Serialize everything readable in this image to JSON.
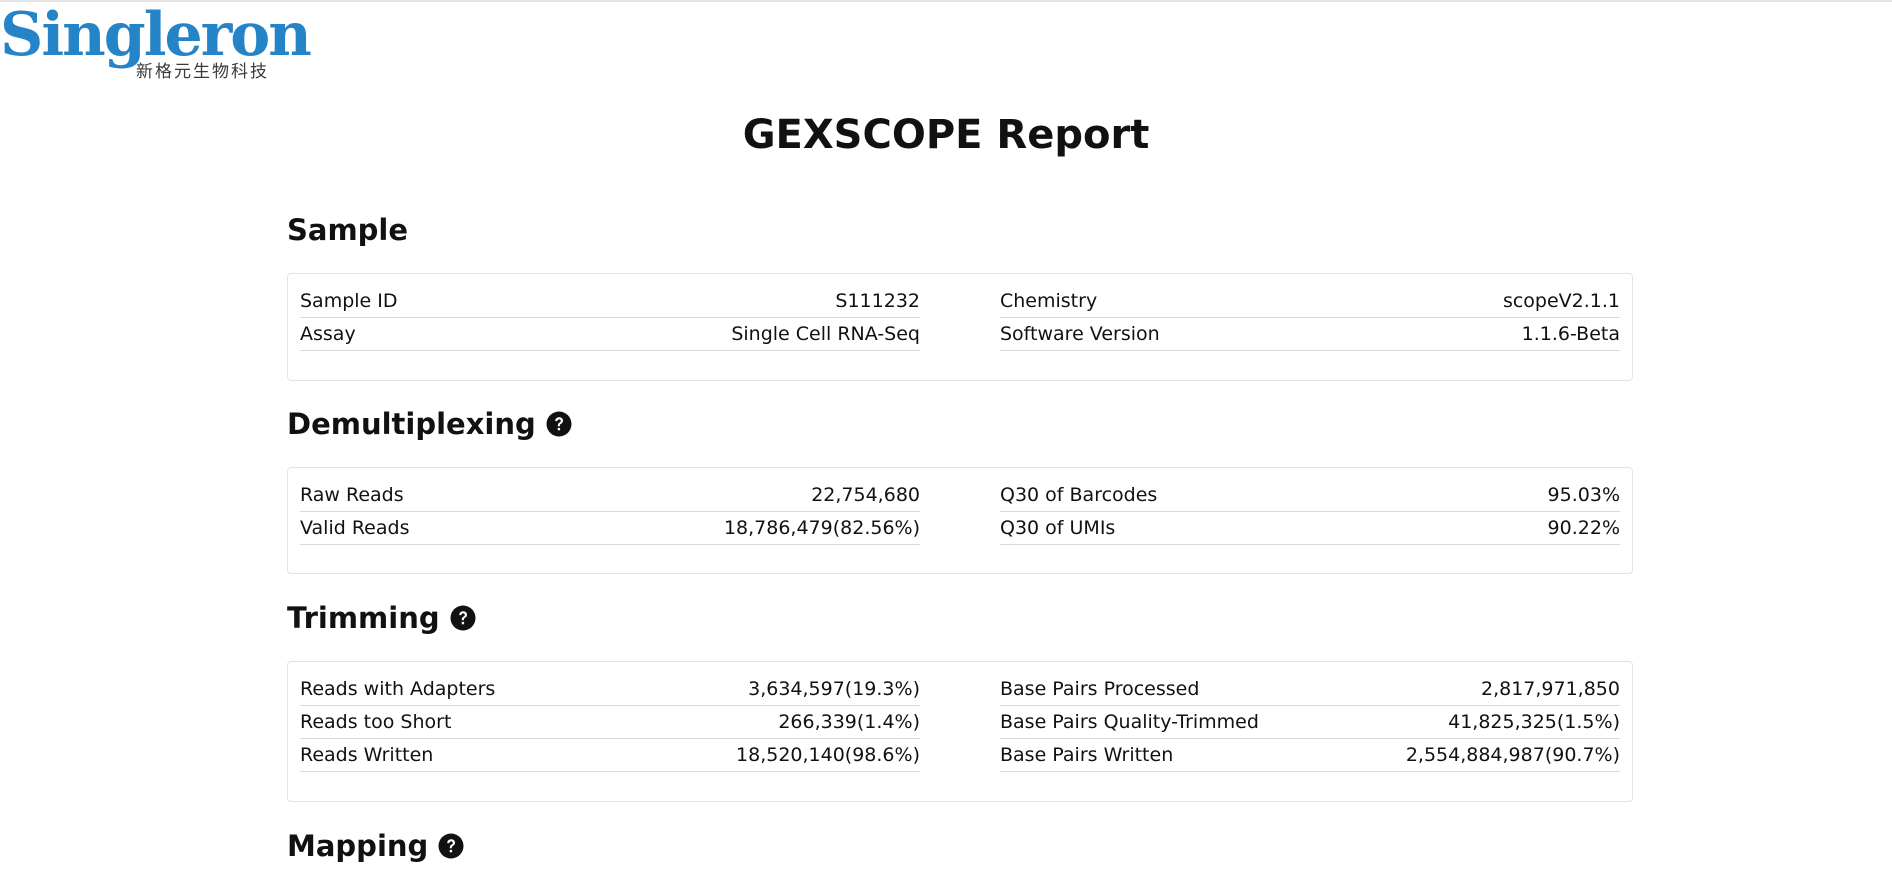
{
  "logo": {
    "word": "Singleron",
    "subtitle": "新格元生物科技",
    "color": "#2584c8"
  },
  "title": "GEXSCOPE Report",
  "help_icon": "question-circle-icon",
  "sections": {
    "sample": {
      "title": "Sample",
      "left": [
        {
          "label": "Sample ID",
          "value": "S111232"
        },
        {
          "label": "Assay",
          "value": "Single Cell RNA-Seq"
        }
      ],
      "right": [
        {
          "label": "Chemistry",
          "value": "scopeV2.1.1"
        },
        {
          "label": "Software Version",
          "value": "1.1.6-Beta"
        }
      ]
    },
    "demultiplexing": {
      "title": "Demultiplexing",
      "left": [
        {
          "label": "Raw Reads",
          "value": "22,754,680"
        },
        {
          "label": "Valid Reads",
          "value": "18,786,479(82.56%)"
        }
      ],
      "right": [
        {
          "label": "Q30 of Barcodes",
          "value": "95.03%"
        },
        {
          "label": "Q30 of UMIs",
          "value": "90.22%"
        }
      ]
    },
    "trimming": {
      "title": "Trimming",
      "left": [
        {
          "label": "Reads with Adapters",
          "value": "3,634,597(19.3%)"
        },
        {
          "label": "Reads too Short",
          "value": "266,339(1.4%)"
        },
        {
          "label": "Reads Written",
          "value": "18,520,140(98.6%)"
        }
      ],
      "right": [
        {
          "label": "Base Pairs Processed",
          "value": "2,817,971,850"
        },
        {
          "label": "Base Pairs Quality-Trimmed",
          "value": "41,825,325(1.5%)"
        },
        {
          "label": "Base Pairs Written",
          "value": "2,554,884,987(90.7%)"
        }
      ]
    },
    "mapping": {
      "title": "Mapping"
    }
  }
}
